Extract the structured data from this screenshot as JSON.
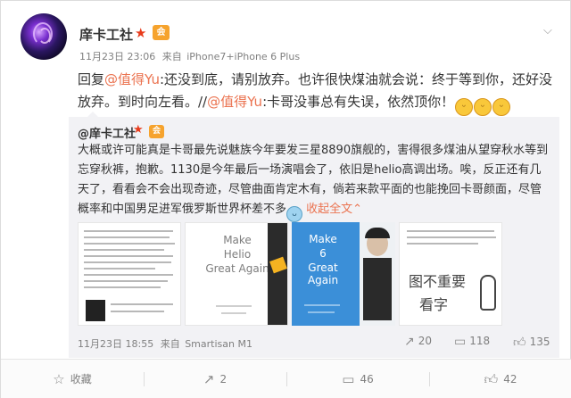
{
  "post": {
    "username": "庠卡工社",
    "member_badge": "会",
    "time": "11月23日 23:06",
    "source_prefix": "来自",
    "source": "iPhone7+iPhone 6 Plus",
    "text_parts": {
      "p1": "回复",
      "m1": "@值得Yu",
      "p2": ":还没到底，请别放弃。也许很快煤油就会说：终于等到你，还好没放弃。到时向左看。//",
      "m2": "@值得Yu",
      "p3": ":卡哥没事总有失误，依然顶你！"
    }
  },
  "repost": {
    "username": "@庠卡工社",
    "member_badge": "会",
    "text": "大概或许可能真是卡哥最先说魅族今年要发三星8890旗舰的，害得很多煤油从望穿秋水等到忘穿秋裤，抱歉。1130是今年最后一场演唱会了，依旧是helio高调出场。唉，反正还有几天了，看看会不会出现奇迹，尽管曲面肯定木有，倘若来款平面的也能挽回卡哥颜面，尽管概率和中国男足进军俄罗斯世界杯差不多",
    "collapse_label": "收起全文",
    "time": "11月23日 18:55",
    "source_prefix": "来自",
    "source": "Smartisan M1",
    "actions": {
      "forward_count": "20",
      "comment_count": "118",
      "like_count": "135"
    },
    "images": {
      "img2_line1": "Make",
      "img2_line2": "Helio",
      "img2_line3": "Great Again",
      "img3_line1": "Make",
      "img3_line2": "6",
      "img3_line3": "Great Again",
      "img4_hand1": "图不重要",
      "img4_hand2": "看字"
    }
  },
  "bottom_bar": {
    "favorite_label": "收藏",
    "forward_count": "2",
    "comment_count": "46",
    "like_count": "42"
  },
  "icons": {
    "vip": "star-icon",
    "chevron": "chevron-down-icon",
    "forward": "forward-icon",
    "comment": "comment-icon",
    "like": "thumb-up-icon",
    "favorite": "bookmark-icon"
  },
  "colors": {
    "accent": "#eb7350",
    "vip_star": "#e83b1b",
    "member_badge": "#f6a32d",
    "repost_bg": "#f2f2f5"
  }
}
